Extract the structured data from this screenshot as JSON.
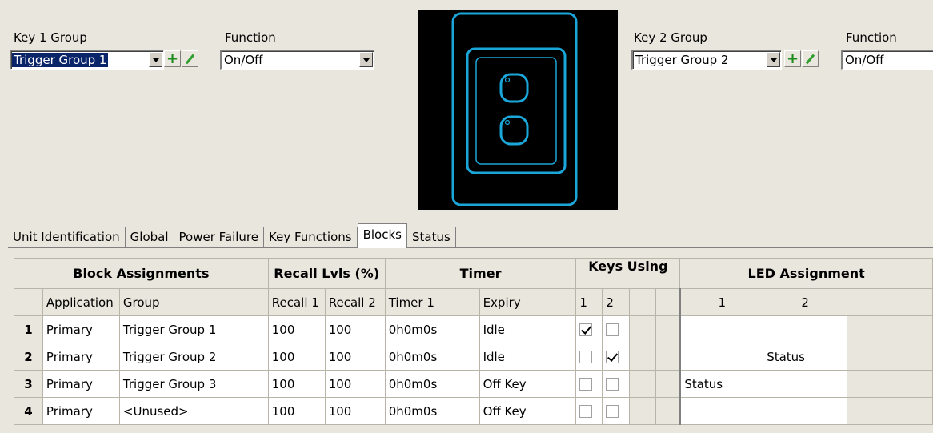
{
  "key1": {
    "group_label": "Key 1 Group",
    "group_value": "Trigger Group 1",
    "function_label": "Function",
    "function_value": "On/Off"
  },
  "key2": {
    "group_label": "Key 2 Group",
    "group_value": "Trigger Group 2",
    "function_label": "Function",
    "function_value": "On/Off"
  },
  "toolbar_icons": [
    "chevron-down-icon",
    "plus-icon",
    "pencil-icon"
  ],
  "tabs": [
    {
      "label": "Unit Identification",
      "active": false
    },
    {
      "label": "Global",
      "active": false
    },
    {
      "label": "Power Failure",
      "active": false
    },
    {
      "label": "Key Functions",
      "active": false
    },
    {
      "label": "Blocks",
      "active": true
    },
    {
      "label": "Status",
      "active": false
    }
  ],
  "table": {
    "group_headers": {
      "block_assignments": "Block Assignments",
      "recall_lvls": "Recall Lvls (%)",
      "timer": "Timer",
      "keys_using": "Keys Using",
      "led_assignment": "LED Assignment"
    },
    "columns": {
      "application": "Application",
      "group": "Group",
      "recall1": "Recall 1",
      "recall2": "Recall 2",
      "timer1": "Timer 1",
      "expiry": "Expiry",
      "key1": "1",
      "key2": "2",
      "led1": "1",
      "led2": "2"
    },
    "rows": [
      {
        "num": "1",
        "application": "Primary",
        "group": "Trigger Group 1",
        "recall1": "100",
        "recall2": "100",
        "timer1": "0h0m0s",
        "expiry": "Idle",
        "key1": true,
        "key2": false,
        "led1": "",
        "led2": ""
      },
      {
        "num": "2",
        "application": "Primary",
        "group": "Trigger Group 2",
        "recall1": "100",
        "recall2": "100",
        "timer1": "0h0m0s",
        "expiry": "Idle",
        "key1": false,
        "key2": true,
        "led1": "",
        "led2": "Status"
      },
      {
        "num": "3",
        "application": "Primary",
        "group": "Trigger Group 3",
        "recall1": "100",
        "recall2": "100",
        "timer1": "0h0m0s",
        "expiry": "Off Key",
        "key1": false,
        "key2": false,
        "led1": "Status",
        "led2": ""
      },
      {
        "num": "4",
        "application": "Primary",
        "group": "<Unused>",
        "recall1": "100",
        "recall2": "100",
        "timer1": "0h0m0s",
        "expiry": "Off Key",
        "key1": false,
        "key2": false,
        "led1": "",
        "led2": ""
      }
    ]
  },
  "colors": {
    "panel_bg": "#e9e6dd",
    "selection": "#0a246a",
    "switch_outline": "#1aa6d8",
    "add_icon": "#1c8c1c"
  }
}
